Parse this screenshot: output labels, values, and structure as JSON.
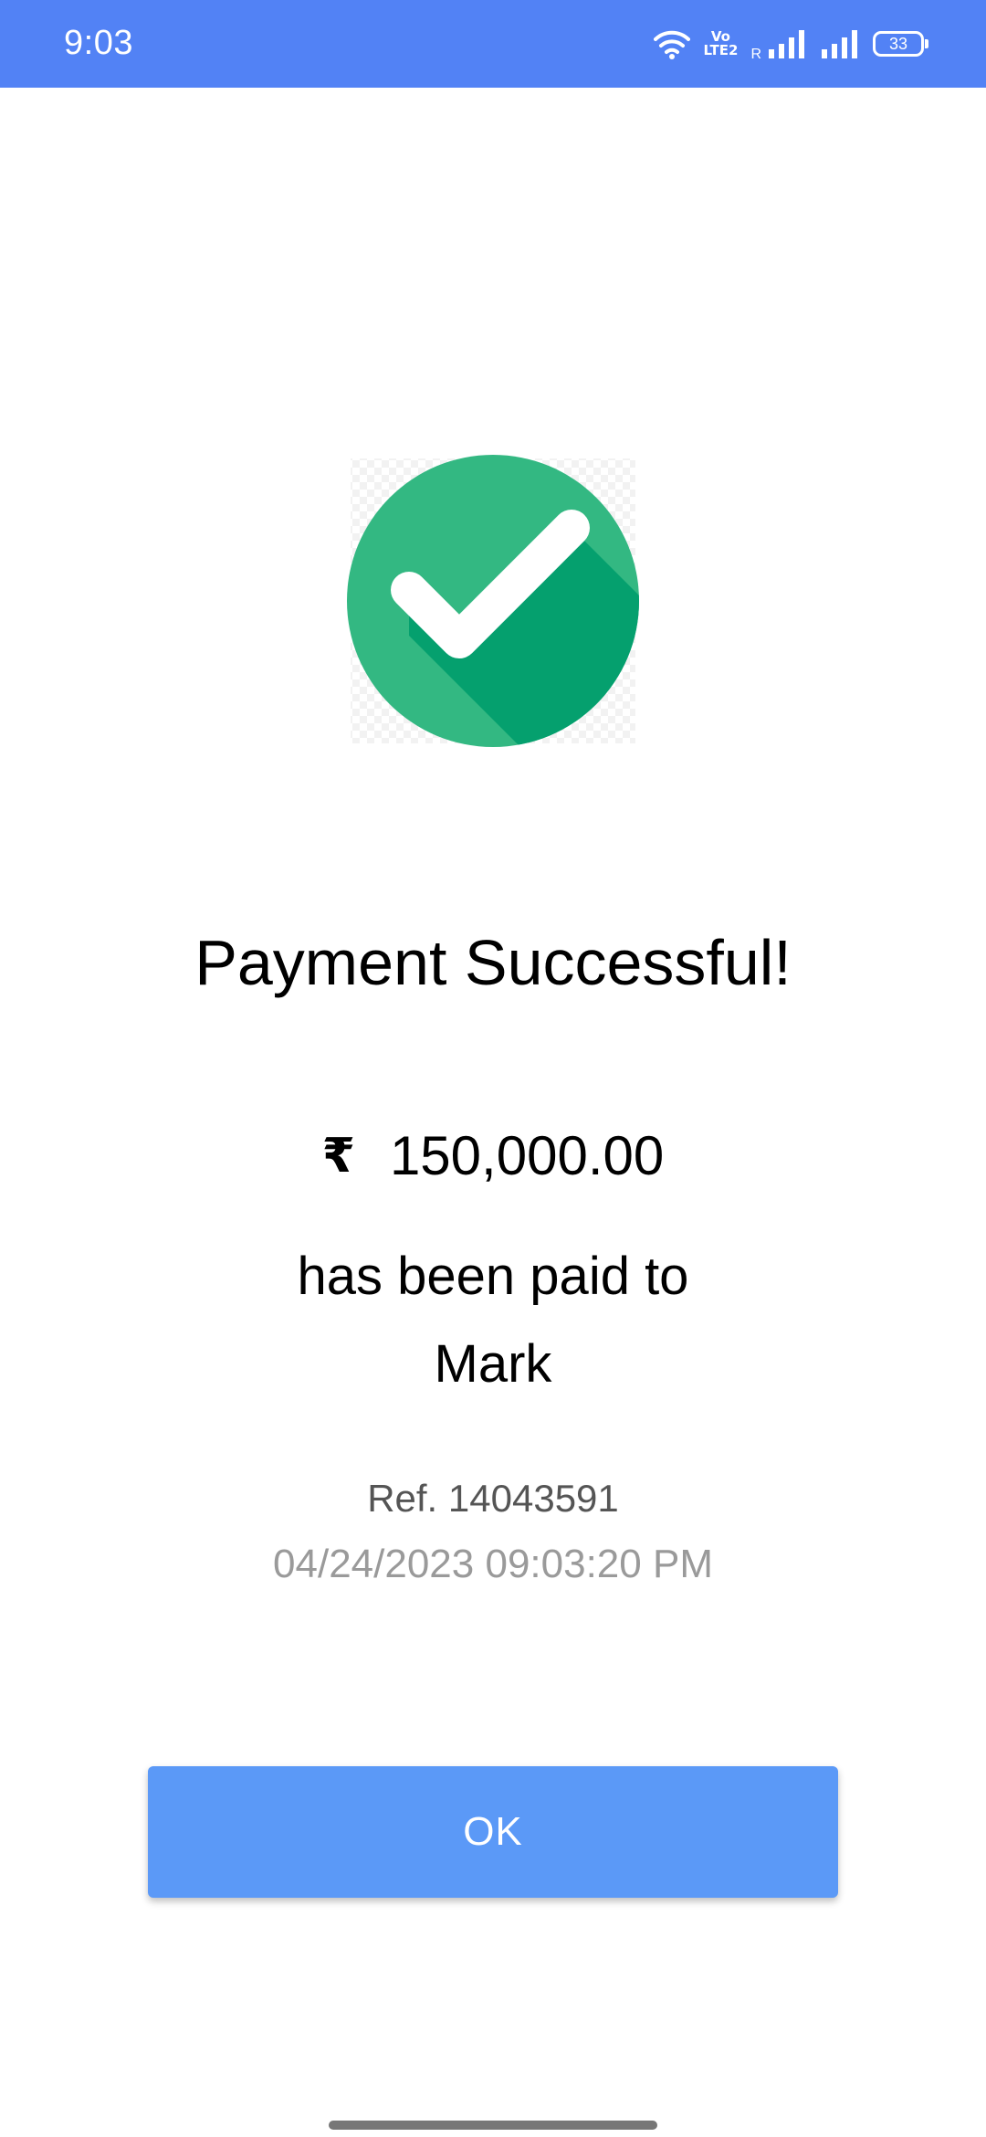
{
  "status_bar": {
    "time": "9:03",
    "volte_top": "Vo",
    "volte_bottom": "LTE2",
    "roaming": "R",
    "battery": "33",
    "icons": [
      "wifi-icon",
      "volte-icon",
      "signal-icon",
      "battery-icon"
    ]
  },
  "success": {
    "icon": "check-circle-icon",
    "title": "Payment Successful!",
    "currency_symbol": "₹",
    "amount": "150,000.00",
    "paid_to_text": "has been paid to",
    "payee": "Mark",
    "reference": "Ref. 14043591",
    "timestamp": "04/24/2023 09:03:20 PM"
  },
  "actions": {
    "ok_label": "OK"
  },
  "colors": {
    "status_bar": "#5282f5",
    "success_green": "#33b882",
    "success_shadow": "#05a06e",
    "button": "#5b99f7"
  }
}
